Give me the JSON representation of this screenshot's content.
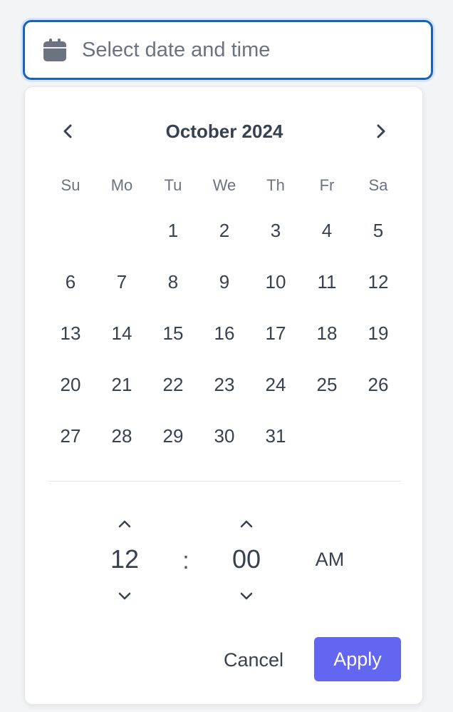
{
  "input": {
    "value": "",
    "placeholder": "Select date and time",
    "icon": "calendar-icon"
  },
  "calendar": {
    "month_title": "October 2024",
    "prev_icon": "chevron-left-icon",
    "next_icon": "chevron-right-icon",
    "weekdays": [
      "Su",
      "Mo",
      "Tu",
      "We",
      "Th",
      "Fr",
      "Sa"
    ],
    "days": [
      "",
      "",
      "1",
      "2",
      "3",
      "4",
      "5",
      "6",
      "7",
      "8",
      "9",
      "10",
      "11",
      "12",
      "13",
      "14",
      "15",
      "16",
      "17",
      "18",
      "19",
      "20",
      "21",
      "22",
      "23",
      "24",
      "25",
      "26",
      "27",
      "28",
      "29",
      "30",
      "31",
      "",
      ""
    ]
  },
  "time": {
    "hour": "12",
    "separator": ":",
    "minute": "00",
    "period": "AM"
  },
  "actions": {
    "cancel_label": "Cancel",
    "apply_label": "Apply"
  },
  "colors": {
    "focus_border": "#1565c0",
    "accent": "#6366f1",
    "text": "#374151",
    "muted": "#6b7280"
  }
}
